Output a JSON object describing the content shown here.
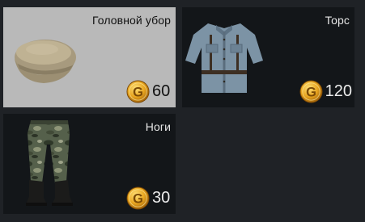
{
  "currency_icon": "gold-coin-g-icon",
  "colors": {
    "slot_bg": "#131619",
    "slot_selected_bg": "#b9b9b9",
    "coin_gold": "#e2a21c"
  },
  "slots": [
    {
      "title": "Головной убор",
      "price": "60",
      "selected": true,
      "item_icon": "cap-icon"
    },
    {
      "title": "Торс",
      "price": "120",
      "selected": false,
      "item_icon": "jacket-icon"
    },
    {
      "title": "Ноги",
      "price": "30",
      "selected": false,
      "item_icon": "camo-pants-boots-icon"
    }
  ]
}
